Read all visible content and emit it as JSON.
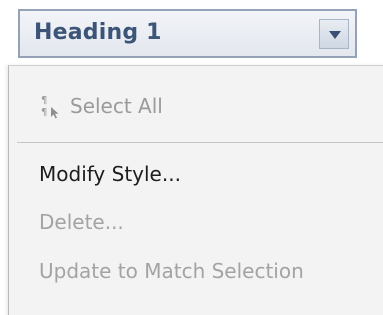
{
  "style_select": {
    "value": "Heading 1",
    "arrow_icon": "chevron-down-icon"
  },
  "menu": {
    "select_all": {
      "label": "Select All",
      "icon": "select-all-icon",
      "enabled": false
    },
    "modify_style": {
      "label": "Modify Style...",
      "enabled": true
    },
    "delete": {
      "label": "Delete...",
      "enabled": false
    },
    "update_to_match": {
      "label": "Update to Match Selection",
      "enabled": false
    }
  },
  "colors": {
    "style_value_text": "#3c5478",
    "disabled_text": "#a3a3a3",
    "enabled_text": "#1d1d1d",
    "menu_background": "#f3f3f3"
  }
}
